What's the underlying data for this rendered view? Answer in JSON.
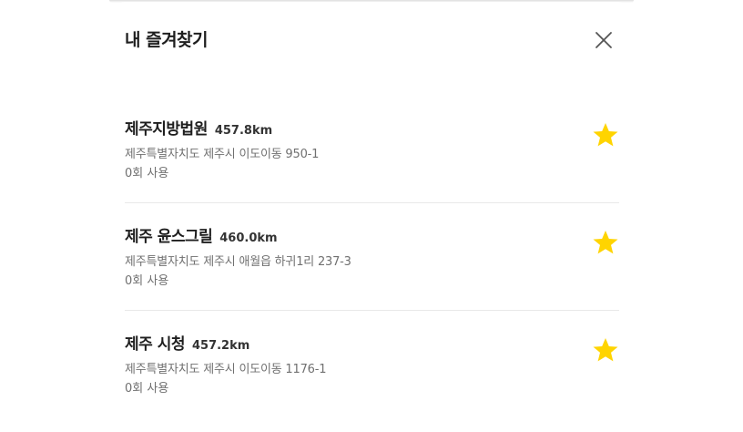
{
  "sheet": {
    "title": "내 즐겨찾기",
    "close_icon": "close-icon"
  },
  "favorites": [
    {
      "name": "제주지방법원",
      "distance": "457.8km",
      "address": "제주특별자치도 제주시 이도이동 950-1",
      "usage": "0회 사용",
      "icon": "star-icon"
    },
    {
      "name": "제주 윤스그릴",
      "distance": "460.0km",
      "address": "제주특별자치도 제주시 애월읍 하귀1리 237-3",
      "usage": "0회 사용",
      "icon": "star-icon"
    },
    {
      "name": "제주 시청",
      "distance": "457.2km",
      "address": "제주특별자치도 제주시 이도이동 1176-1",
      "usage": "0회 사용",
      "icon": "star-icon"
    }
  ],
  "colors": {
    "star": "#FFD400",
    "title": "#1E1E1E",
    "secondary_text": "#707070",
    "divider": "#E8E8E8"
  }
}
